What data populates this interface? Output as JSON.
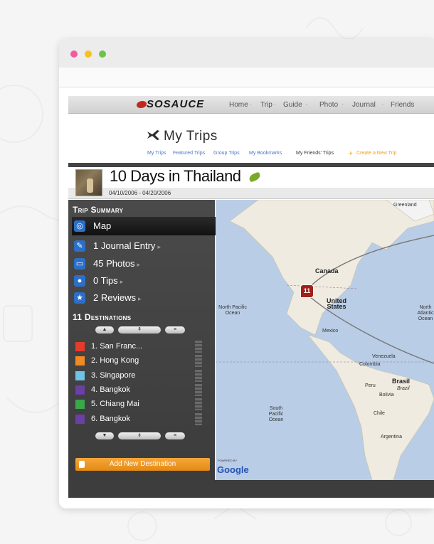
{
  "window": {
    "dot_colors": [
      "#f15ca0",
      "#f6c21c",
      "#6cc24a"
    ]
  },
  "nav": {
    "logo": "SOSAUCE",
    "items": [
      "Home",
      "Trip",
      "Guide",
      "Photo",
      "Journal",
      "Friends"
    ]
  },
  "header": {
    "title": "My Trips",
    "sublinks": [
      "My Trips",
      "Featured Trips",
      "Group Trips",
      "My Bookmarks",
      "My Friends' Trips",
      "Create a New Trip"
    ]
  },
  "trip": {
    "title": "10 Days in Thailand",
    "dates": "04/10/2006 - 04/20/2006"
  },
  "sidebar": {
    "summary_heading": "Trip Summary",
    "items": [
      {
        "label": "Map",
        "icon": "globe-icon",
        "arrow": ""
      },
      {
        "label": "1 Journal Entry",
        "icon": "pen-icon",
        "arrow": "▸"
      },
      {
        "label": "45 Photos",
        "icon": "photo-icon",
        "arrow": "▸"
      },
      {
        "label": "0 Tips",
        "icon": "bulb-icon",
        "arrow": "▸"
      },
      {
        "label": "2 Reviews",
        "icon": "star-icon",
        "arrow": "▸"
      }
    ],
    "destinations_heading": "11 Destinations",
    "destinations": [
      {
        "label": "1. San Franc...",
        "color": "#e53b2c"
      },
      {
        "label": "2. Hong Kong",
        "color": "#f28a24"
      },
      {
        "label": "3. Singapore",
        "color": "#6ec3e6"
      },
      {
        "label": "4. Bangkok",
        "color": "#6a3fa6"
      },
      {
        "label": "5. Chiang Mai",
        "color": "#3aa84a"
      },
      {
        "label": "6. Bangkok",
        "color": "#6a3fa6"
      }
    ],
    "add_button": "Add New Destination"
  },
  "map": {
    "labels": [
      "Greenland",
      "Canada",
      "United States",
      "North Pacific Ocean",
      "North Atlantic Ocean",
      "Mexico",
      "Venezuela",
      "Colombia",
      "Peru",
      "Brasil",
      "Brazil",
      "Bolivia",
      "Chile",
      "South Pacific Ocean",
      "Argentina"
    ],
    "marker": "11",
    "powered": "POWERED BY",
    "google": "Google"
  }
}
